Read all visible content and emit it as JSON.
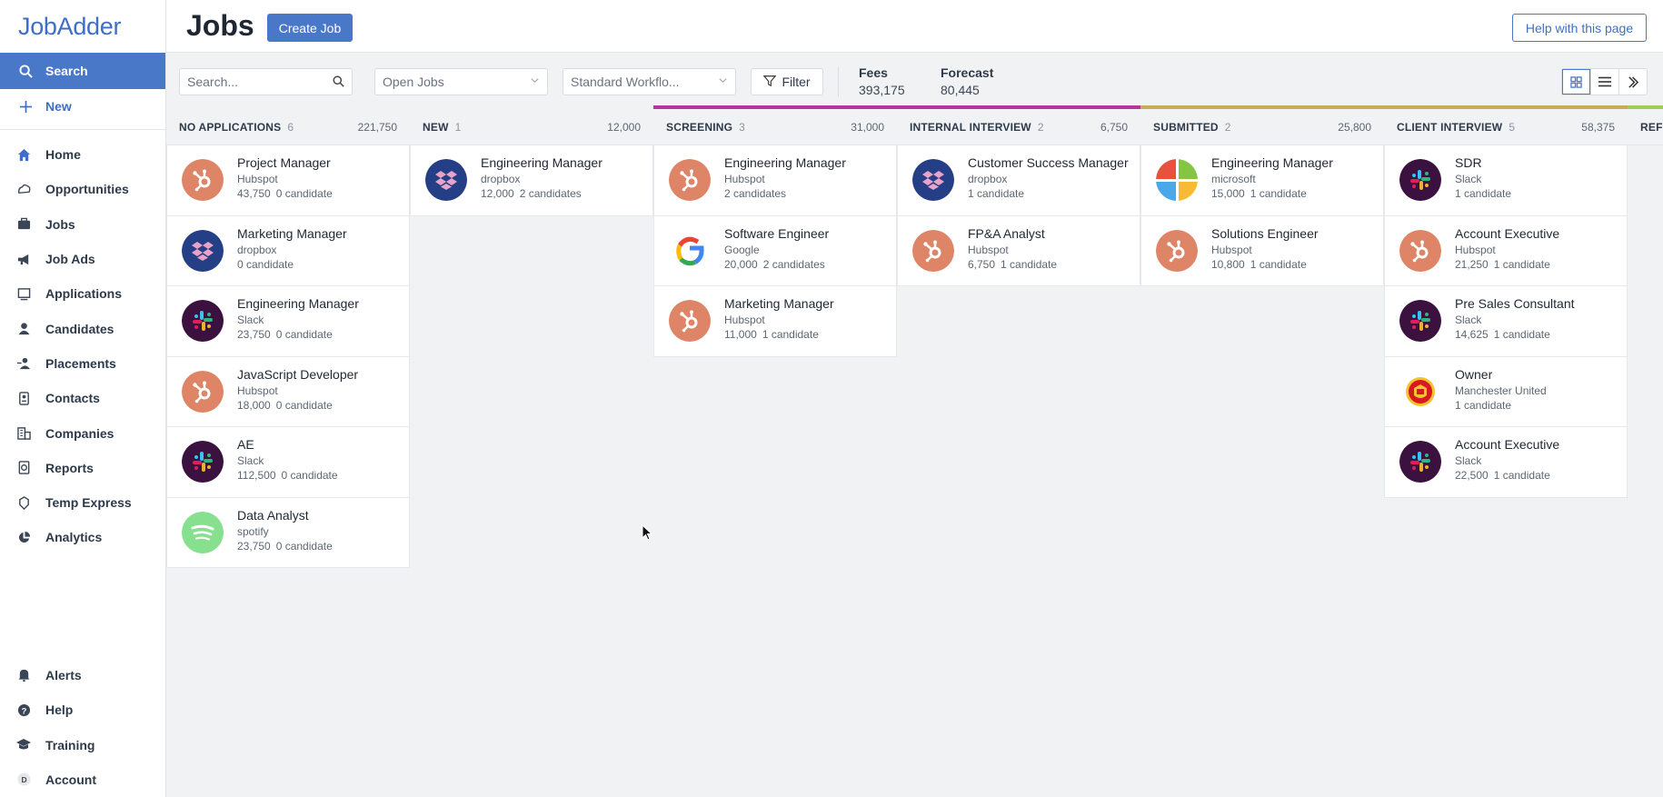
{
  "app": {
    "logo": "JobAdder"
  },
  "sidebar": {
    "search_label": "Search",
    "new_label": "New",
    "items": [
      {
        "label": "Home",
        "icon": "home-icon"
      },
      {
        "label": "Opportunities",
        "icon": "opportunities-icon"
      },
      {
        "label": "Jobs",
        "icon": "briefcase-icon"
      },
      {
        "label": "Job Ads",
        "icon": "megaphone-icon"
      },
      {
        "label": "Applications",
        "icon": "applications-icon"
      },
      {
        "label": "Candidates",
        "icon": "person-icon"
      },
      {
        "label": "Placements",
        "icon": "placements-icon"
      },
      {
        "label": "Contacts",
        "icon": "contacts-icon"
      },
      {
        "label": "Companies",
        "icon": "building-icon"
      },
      {
        "label": "Reports",
        "icon": "reports-icon"
      },
      {
        "label": "Temp Express",
        "icon": "temp-express-icon"
      },
      {
        "label": "Analytics",
        "icon": "pie-chart-icon"
      }
    ],
    "bottom": [
      {
        "label": "Alerts",
        "icon": "bell-icon"
      },
      {
        "label": "Help",
        "icon": "help-icon"
      },
      {
        "label": "Training",
        "icon": "graduation-cap-icon"
      },
      {
        "label": "Account",
        "icon": "account-avatar-icon",
        "avatar_letter": "D"
      }
    ]
  },
  "header": {
    "title": "Jobs",
    "create_button": "Create Job",
    "help_button": "Help with this page"
  },
  "toolbar": {
    "search_placeholder": "Search...",
    "jobs_select": "Open Jobs",
    "workflow_select": "Standard Workflo...",
    "filter_label": "Filter",
    "fees_label": "Fees",
    "fees_value": "393,175",
    "forecast_label": "Forecast",
    "forecast_value": "80,445"
  },
  "colors": {
    "accent": "#4a78c9",
    "screening_bar": "#b5359a",
    "internal_bar": "#b5359a",
    "submitted_bar": "#c9a95a",
    "client_bar": "#c9a95a",
    "next_bar": "#9ccf5a"
  },
  "columns": [
    {
      "name": "NO APPLICATIONS",
      "count": "6",
      "sum": "221,750",
      "cards": [
        {
          "title": "Project Manager",
          "company": "Hubspot",
          "fee": "43,750",
          "candidates": "0 candidate",
          "logo": "hubspot"
        },
        {
          "title": "Marketing Manager",
          "company": "dropbox",
          "fee": "",
          "candidates": "0 candidate",
          "logo": "dropbox"
        },
        {
          "title": "Engineering Manager",
          "company": "Slack",
          "fee": "23,750",
          "candidates": "0 candidate",
          "logo": "slack"
        },
        {
          "title": "JavaScript Developer",
          "company": "Hubspot",
          "fee": "18,000",
          "candidates": "0 candidate",
          "logo": "hubspot"
        },
        {
          "title": "AE",
          "company": "Slack",
          "fee": "112,500",
          "candidates": "0 candidate",
          "logo": "slack"
        },
        {
          "title": "Data Analyst",
          "company": "spotify",
          "fee": "23,750",
          "candidates": "0 candidate",
          "logo": "spotify"
        }
      ]
    },
    {
      "name": "NEW",
      "count": "1",
      "sum": "12,000",
      "cards": [
        {
          "title": "Engineering Manager",
          "company": "dropbox",
          "fee": "12,000",
          "candidates": "2 candidates",
          "logo": "dropbox"
        }
      ]
    },
    {
      "name": "SCREENING",
      "count": "3",
      "sum": "31,000",
      "cards": [
        {
          "title": "Engineering Manager",
          "company": "Hubspot",
          "fee": "",
          "candidates": "2 candidates",
          "logo": "hubspot"
        },
        {
          "title": "Software Engineer",
          "company": "Google",
          "fee": "20,000",
          "candidates": "2 candidates",
          "logo": "google"
        },
        {
          "title": "Marketing Manager",
          "company": "Hubspot",
          "fee": "11,000",
          "candidates": "1 candidate",
          "logo": "hubspot"
        }
      ]
    },
    {
      "name": "INTERNAL INTERVIEW",
      "count": "2",
      "sum": "6,750",
      "cards": [
        {
          "title": "Customer Success Manager",
          "company": "dropbox",
          "fee": "",
          "candidates": "1 candidate",
          "logo": "dropbox"
        },
        {
          "title": "FP&A Analyst",
          "company": "Hubspot",
          "fee": "6,750",
          "candidates": "1 candidate",
          "logo": "hubspot"
        }
      ]
    },
    {
      "name": "SUBMITTED",
      "count": "2",
      "sum": "25,800",
      "cards": [
        {
          "title": "Engineering Manager",
          "company": "microsoft",
          "fee": "15,000",
          "candidates": "1 candidate",
          "logo": "microsoft"
        },
        {
          "title": "Solutions Engineer",
          "company": "Hubspot",
          "fee": "10,800",
          "candidates": "1 candidate",
          "logo": "hubspot"
        }
      ]
    },
    {
      "name": "CLIENT INTERVIEW",
      "count": "5",
      "sum": "58,375",
      "cards": [
        {
          "title": "SDR",
          "company": "Slack",
          "fee": "",
          "candidates": "1 candidate",
          "logo": "slack"
        },
        {
          "title": "Account Executive",
          "company": "Hubspot",
          "fee": "21,250",
          "candidates": "1 candidate",
          "logo": "hubspot"
        },
        {
          "title": "Pre Sales Consultant",
          "company": "Slack",
          "fee": "14,625",
          "candidates": "1 candidate",
          "logo": "slack"
        },
        {
          "title": "Owner",
          "company": "Manchester United",
          "fee": "",
          "candidates": "1 candidate",
          "logo": "manutd"
        },
        {
          "title": "Account Executive",
          "company": "Slack",
          "fee": "22,500",
          "candidates": "1 candidate",
          "logo": "slack"
        }
      ]
    },
    {
      "name": "REF",
      "count": "",
      "sum": "",
      "cards": []
    }
  ]
}
